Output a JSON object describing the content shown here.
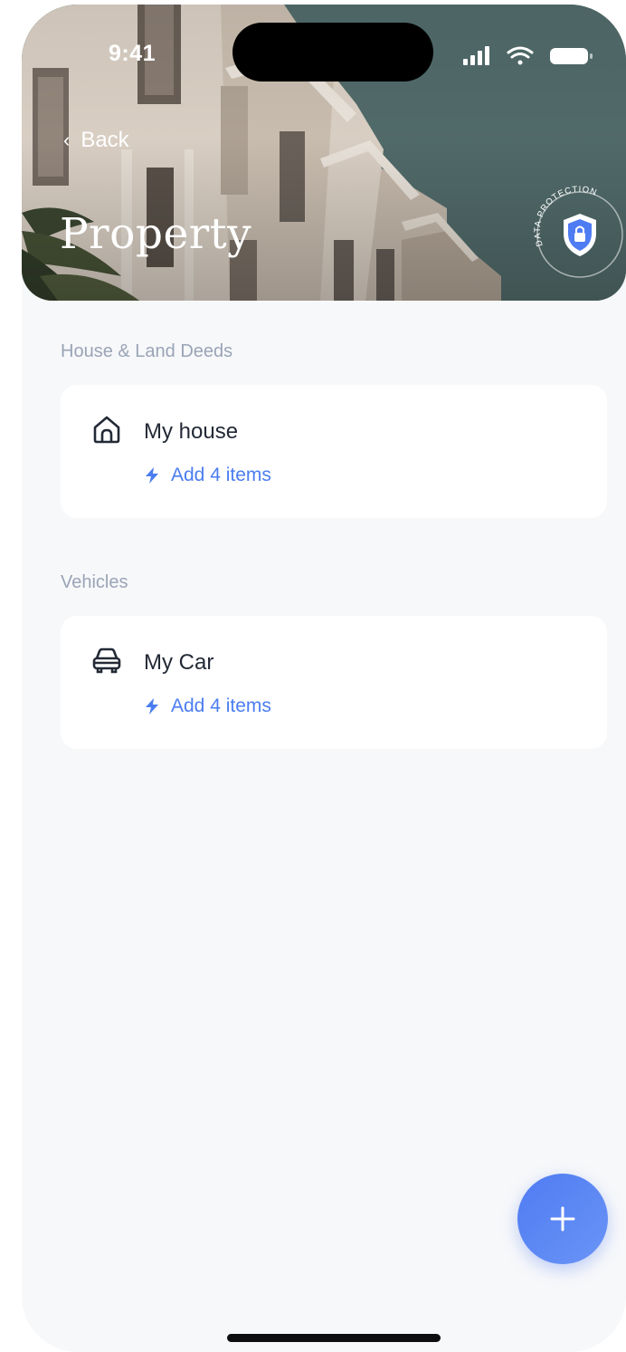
{
  "status_bar": {
    "time": "9:41",
    "icons": [
      "signal-icon",
      "wifi-icon",
      "battery-icon"
    ]
  },
  "header": {
    "back_label": "Back",
    "title": "Property",
    "badge_text": "DATA PROTECTION",
    "badge_icon": "shield-lock-icon"
  },
  "sections": [
    {
      "label": "House & Land Deeds",
      "item": {
        "icon": "house-icon",
        "title": "My house",
        "action_icon": "bolt-icon",
        "action_label": "Add 4 items"
      }
    },
    {
      "label": "Vehicles",
      "item": {
        "icon": "car-icon",
        "title": "My Car",
        "action_icon": "bolt-icon",
        "action_label": "Add 4 items"
      }
    }
  ],
  "fab": {
    "icon": "plus-icon"
  },
  "colors": {
    "accent": "#4a7df0",
    "background": "#f7f8fa",
    "card": "#ffffff",
    "text_primary": "#232a36",
    "text_secondary": "#9aa4b6"
  }
}
